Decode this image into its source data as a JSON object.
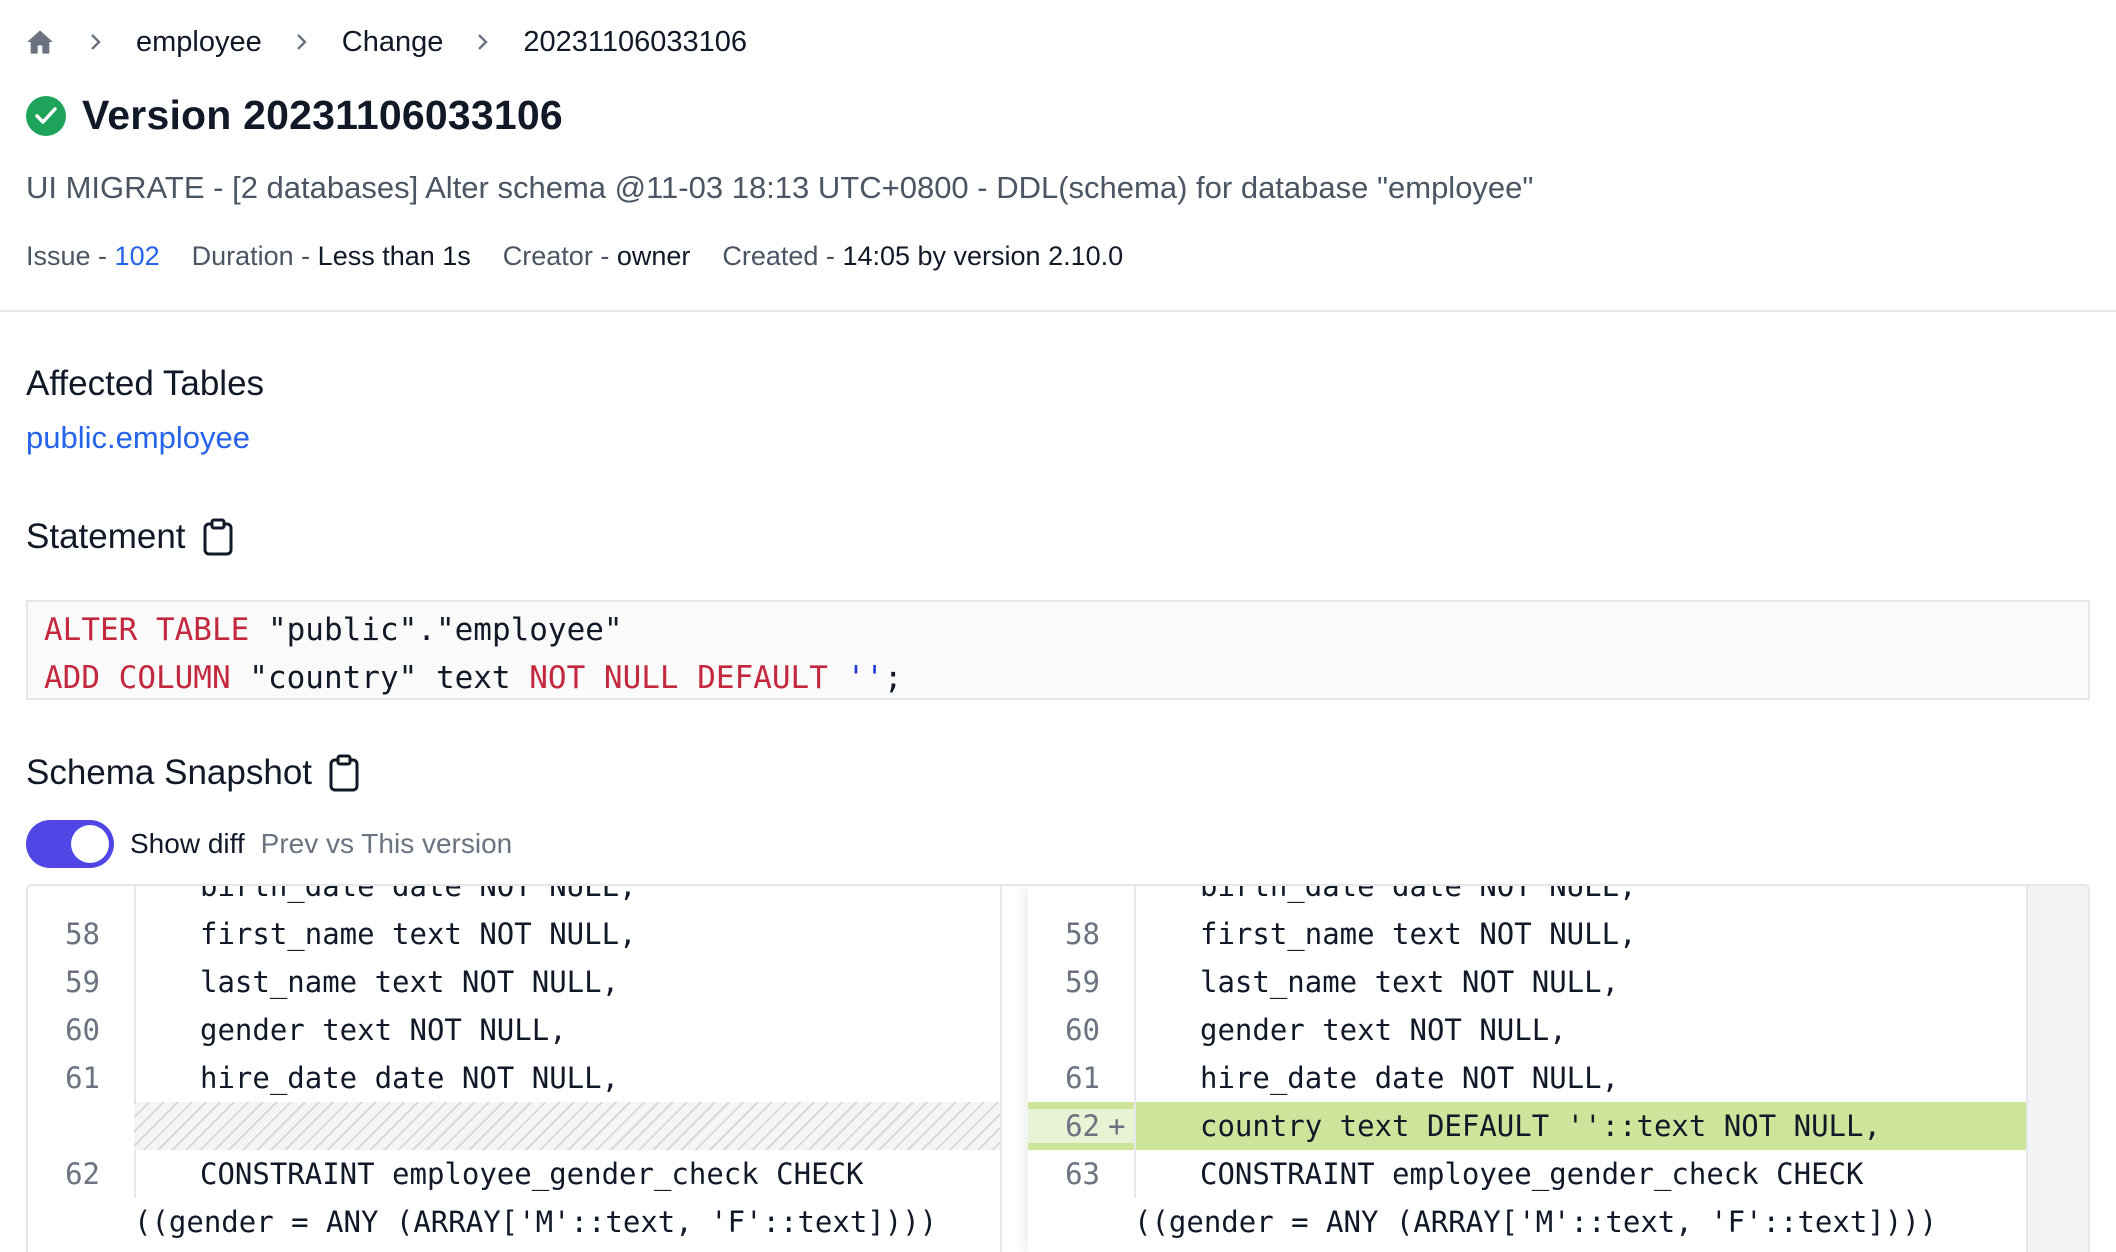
{
  "breadcrumb": {
    "items": [
      "employee",
      "Change",
      "20231106033106"
    ]
  },
  "header": {
    "title": "Version 20231106033106",
    "description": "UI MIGRATE - [2 databases] Alter schema @11-03 18:13 UTC+0800 - DDL(schema) for database \"employee\""
  },
  "meta": {
    "issue_label": "Issue -",
    "issue_value": "102",
    "duration_label": "Duration -",
    "duration_value": "Less than 1s",
    "creator_label": "Creator -",
    "creator_value": "owner",
    "created_label": "Created -",
    "created_value": "14:05 by version 2.10.0"
  },
  "affected": {
    "heading": "Affected Tables",
    "table": "public.employee"
  },
  "statement": {
    "heading": "Statement",
    "line1": {
      "kw": "ALTER TABLE",
      "rest": " \"public\".\"employee\""
    },
    "line2": {
      "kw1": "ADD COLUMN",
      "mid": " \"country\" text ",
      "kw2": "NOT NULL DEFAULT",
      "sp": " ",
      "lit": "''",
      "end": ";"
    }
  },
  "snapshot": {
    "heading": "Schema Snapshot",
    "toggle_label": "Show diff",
    "toggle_sub": "Prev vs This version",
    "toggle_on": true
  },
  "diff": {
    "left": {
      "top_partial": "birth_date date NOT NULL,",
      "n58": "58",
      "l58": "first_name text NOT NULL,",
      "n59": "59",
      "l59": "last_name text NOT NULL,",
      "n60": "60",
      "l60": "gender text NOT NULL,",
      "n61": "61",
      "l61": "hire_date date NOT NULL,",
      "n62": "62",
      "l62": "CONSTRAINT employee_gender_check CHECK",
      "wrap": "((gender = ANY (ARRAY['M'::text, 'F'::text])))"
    },
    "right": {
      "top_partial": "birth_date date NOT NULL,",
      "n58": "58",
      "l58": "first_name text NOT NULL,",
      "n59": "59",
      "l59": "last_name text NOT NULL,",
      "n60": "60",
      "l60": "gender text NOT NULL,",
      "n61": "61",
      "l61": "hire_date date NOT NULL,",
      "n62": "62",
      "l62": "country text DEFAULT ''::text NOT NULL,",
      "n63": "63",
      "l63": "CONSTRAINT employee_gender_check CHECK",
      "wrap": "((gender = ANY (ARRAY['M'::text, 'F'::text])))"
    },
    "added_marker": "+"
  },
  "colors": {
    "accent": "#4f46e5",
    "link": "#2563eb",
    "success": "#1ea45a",
    "added_bg": "#cce59b",
    "keyword": "#c4283e"
  }
}
